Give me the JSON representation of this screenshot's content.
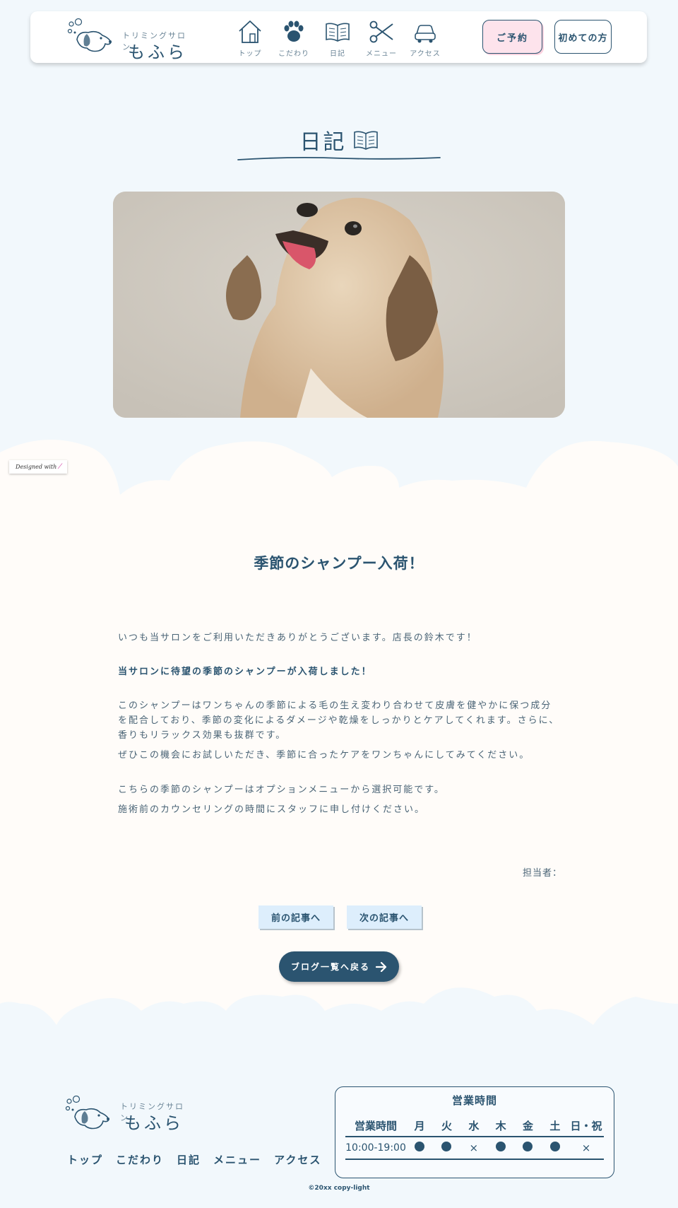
{
  "header": {
    "logo_sub": "トリミングサロン",
    "logo_main": "もふら",
    "nav": [
      {
        "label": "トップ",
        "icon": "house-icon"
      },
      {
        "label": "こだわり",
        "icon": "paw-icon"
      },
      {
        "label": "日記",
        "icon": "book-icon"
      },
      {
        "label": "メニュー",
        "icon": "scissors-icon"
      },
      {
        "label": "アクセス",
        "icon": "car-icon"
      }
    ],
    "reserve_label": "ご予約",
    "first_label": "初めての方"
  },
  "page": {
    "title": "日記"
  },
  "badge": {
    "designed_with": "Designed with"
  },
  "article": {
    "title": "季節のシャンプー入荷！",
    "p1": "いつも当サロンをご利用いただきありがとうございます。店長の鈴木です！",
    "p2": "当サロンに待望の季節のシャンプーが入荷しました！",
    "p3": "このシャンプーはワンちゃんの季節による毛の生え変わり合わせて皮膚を健やかに保つ成分を配合しており、季節の変化によるダメージや乾燥をしっかりとケアしてくれます。さらに、香りもリラックス効果も抜群です。",
    "p4": "ぜひこの機会にお試しいただき、季節に合ったケアをワンちゃんにしてみてください。",
    "p5": "こちらの季節のシャンプーはオプションメニューから選択可能です。",
    "p6": "施術前のカウンセリングの時間にスタッフに申し付けください。",
    "author_label": "担当者："
  },
  "pager": {
    "prev": "前の記事へ",
    "next": "次の記事へ",
    "back": "ブログ一覧へ戻る"
  },
  "footer": {
    "logo_sub": "トリミングサロン",
    "logo_main": "もふら",
    "nav": [
      "トップ",
      "こだわり",
      "日記",
      "メニュー",
      "アクセス"
    ],
    "hours_title": "営業時間",
    "hours_headers": [
      "営業時間",
      "月",
      "火",
      "水",
      "木",
      "金",
      "土",
      "日・祝"
    ],
    "hours_time": "10:00-19:00",
    "hours_status": [
      "open",
      "open",
      "closed",
      "open",
      "open",
      "open",
      "closed"
    ],
    "closed_mark": "×",
    "copyright": "©20xx copy-light"
  },
  "colors": {
    "navy": "#2b5470",
    "background": "#f2f8fc",
    "cream": "#fffcf9",
    "pink": "#fde3ec",
    "light_blue_button": "#ddeefc"
  }
}
